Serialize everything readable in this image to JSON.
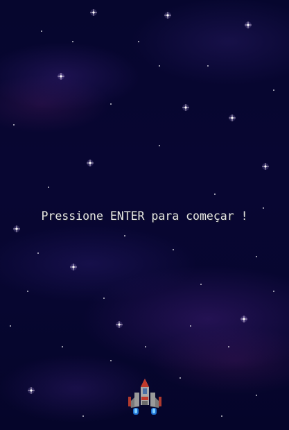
{
  "screen": {
    "prompt_text": "Pressione ENTER para começar !"
  },
  "colors": {
    "background": "#05052a",
    "text": "#e6e6e6",
    "star": "#ffffff",
    "ship_hull": "#8a8a8a",
    "ship_accent": "#c0392b",
    "thruster": "#3aa0ff"
  },
  "player": {
    "sprite": "spaceship-icon"
  }
}
